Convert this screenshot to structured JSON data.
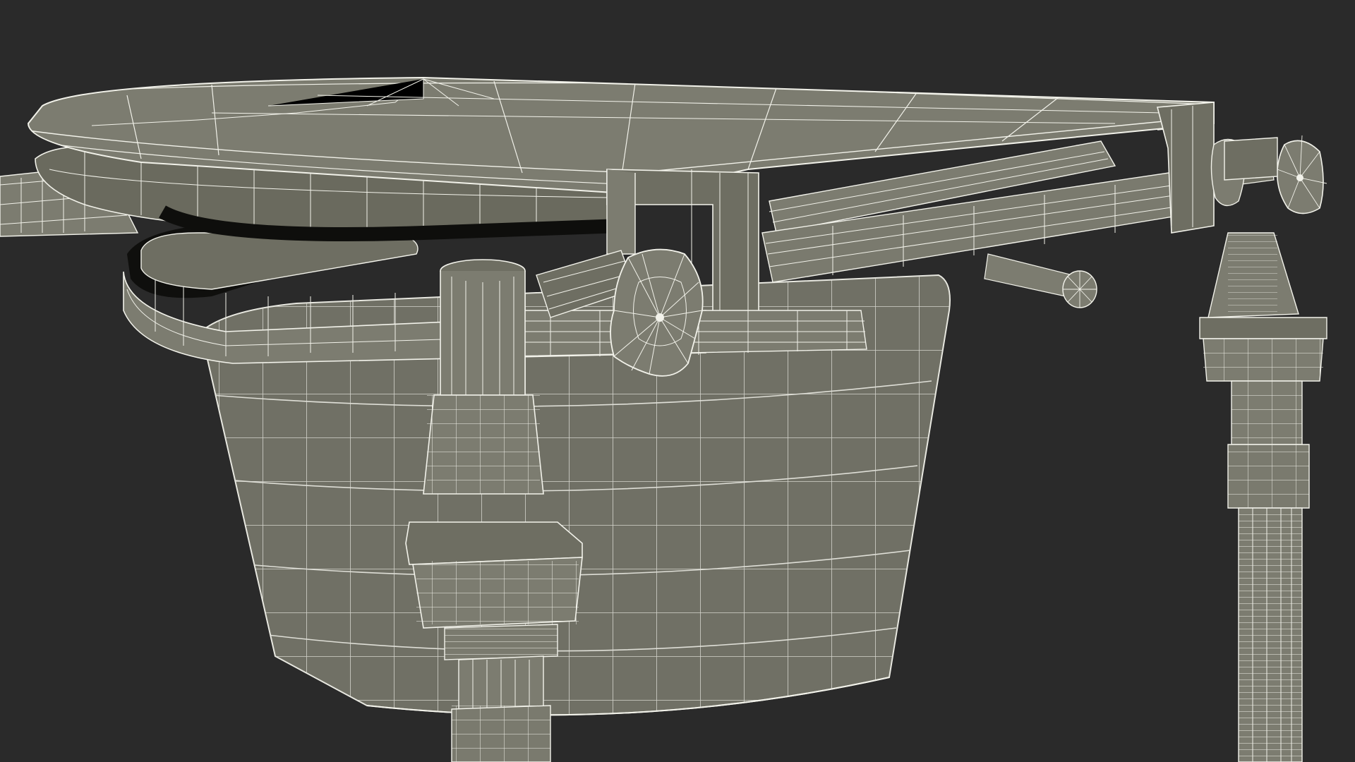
{
  "scene": {
    "subject": "commode-chair-wireframe-render",
    "colors": {
      "background": "#2a2a2a",
      "surface": "#7c7c70",
      "surface_light": "#8a8a7e",
      "surface_dark": "#5e5e54",
      "wire": "#f2f2ea",
      "shadow": "#141412",
      "interior": "#0e0e0c"
    }
  }
}
